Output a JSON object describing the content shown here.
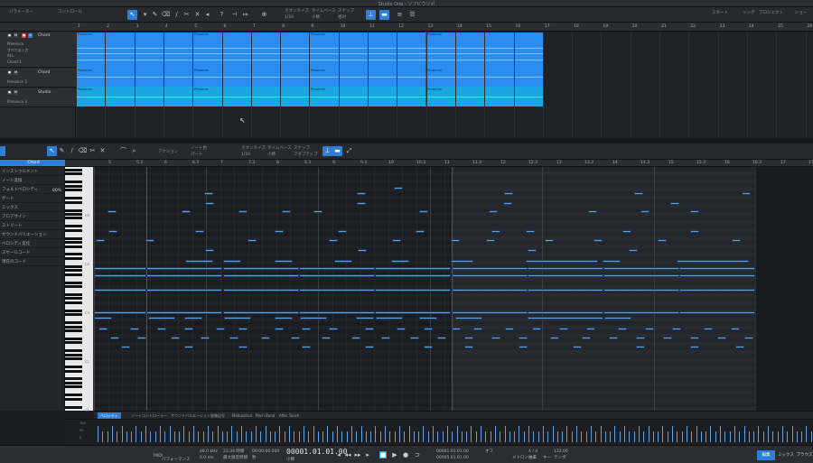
{
  "window": {
    "title": "Studio One - ソフビウソポ"
  },
  "toolbar": {
    "left_tabs": [
      "パラメーター",
      "コントロール"
    ],
    "quantize_label": "クオンタイズ",
    "quantize_value": "1/16",
    "timebase_label": "タイムベース",
    "timebase_value": "小節",
    "snap_label": "スナップ",
    "snap_value": "相対",
    "right_items": [
      "スタート",
      "ソング",
      "プロジェクト",
      "ショー"
    ]
  },
  "tracks": [
    {
      "name": "Chord",
      "subs": [
        "Presence",
        "すべての入力",
        "ALL",
        "Chord 1"
      ]
    },
    {
      "name": "Chord",
      "subs": [
        "Presence 2"
      ]
    },
    {
      "name": "Studio",
      "subs": [
        "Presence 3"
      ]
    }
  ],
  "ruler_top": [
    "1",
    "2",
    "3",
    "4",
    "5",
    "6",
    "7",
    "8",
    "9",
    "10",
    "11",
    "12",
    "13",
    "14",
    "15",
    "16",
    "17",
    "18",
    "19",
    "20",
    "21",
    "22",
    "23",
    "24",
    "25",
    "26",
    "27"
  ],
  "parts": {
    "label": "Presence"
  },
  "editor_toolbar": {
    "action_label": "アクション",
    "note_color_label": "ノート色",
    "note_color_value": "パート",
    "quantize_label": "クオンタイズ",
    "quantize_value": "1/16",
    "timebase_label": "タイムベース",
    "timebase_value": "小節",
    "snap_label": "スナップ",
    "snap_value": "アダプティブ"
  },
  "inspector": {
    "items": [
      "インストゥルメント",
      "ノート変換",
      "フォルトベロシティ",
      "ゲート",
      "ミックス",
      "フロアサイン",
      "ストリート",
      "サウンドバリエーション",
      "ベロシティ変化",
      "スケールコード",
      "現在のコード"
    ],
    "track_name": "Chord",
    "velocity_value": "80%"
  },
  "ruler_bottom": [
    "5",
    "5.3",
    "6",
    "6.3",
    "7",
    "7.3",
    "8",
    "8.3",
    "9",
    "9.3",
    "10",
    "10.3",
    "11",
    "11.3",
    "12",
    "12.3",
    "13",
    "13.3",
    "14",
    "14.3",
    "15",
    "15.3",
    "16",
    "16.3",
    "17",
    "17.3"
  ],
  "keyboard": {
    "c_labels": [
      "C5",
      "C4",
      "C3",
      "C2",
      "C1"
    ]
  },
  "lane_tabs": [
    "ベロシティ",
    "ノートコントローラー",
    "サウンドバリエーション",
    "装飾記号",
    "Modulation",
    "Pitch Bend",
    "After Touch"
  ],
  "velocity_scale": [
    "100",
    "50",
    "0"
  ],
  "transport": {
    "midi_label": "MIDI",
    "perf_label": "パフォーマンス",
    "sample_rate": "48.0 kHz",
    "latency": "0.0 ms",
    "record_time": "23:34 時間",
    "record_label": "最大録音時間",
    "time_value": "00:00:00.000",
    "time_label": "秒",
    "position": "00001.01.01.00",
    "position_label": "小節",
    "loop_start": "00001.01.01.00",
    "loop_end": "00005.01.01.00",
    "metronome": "オフ",
    "metronome_label": "メトロノーム",
    "signature": "4 / 4",
    "signature_label": "拍子",
    "key_label": "キー",
    "tempo": "132.00",
    "tempo_label": "テンポ",
    "views": [
      "編集",
      "ミックス",
      "ブラウズ"
    ]
  },
  "colors": {
    "accent": "#2f7fd6",
    "note": "#5d9fe0",
    "part_top": "#2a8df0",
    "part_bottom": "#1aa6e0"
  }
}
